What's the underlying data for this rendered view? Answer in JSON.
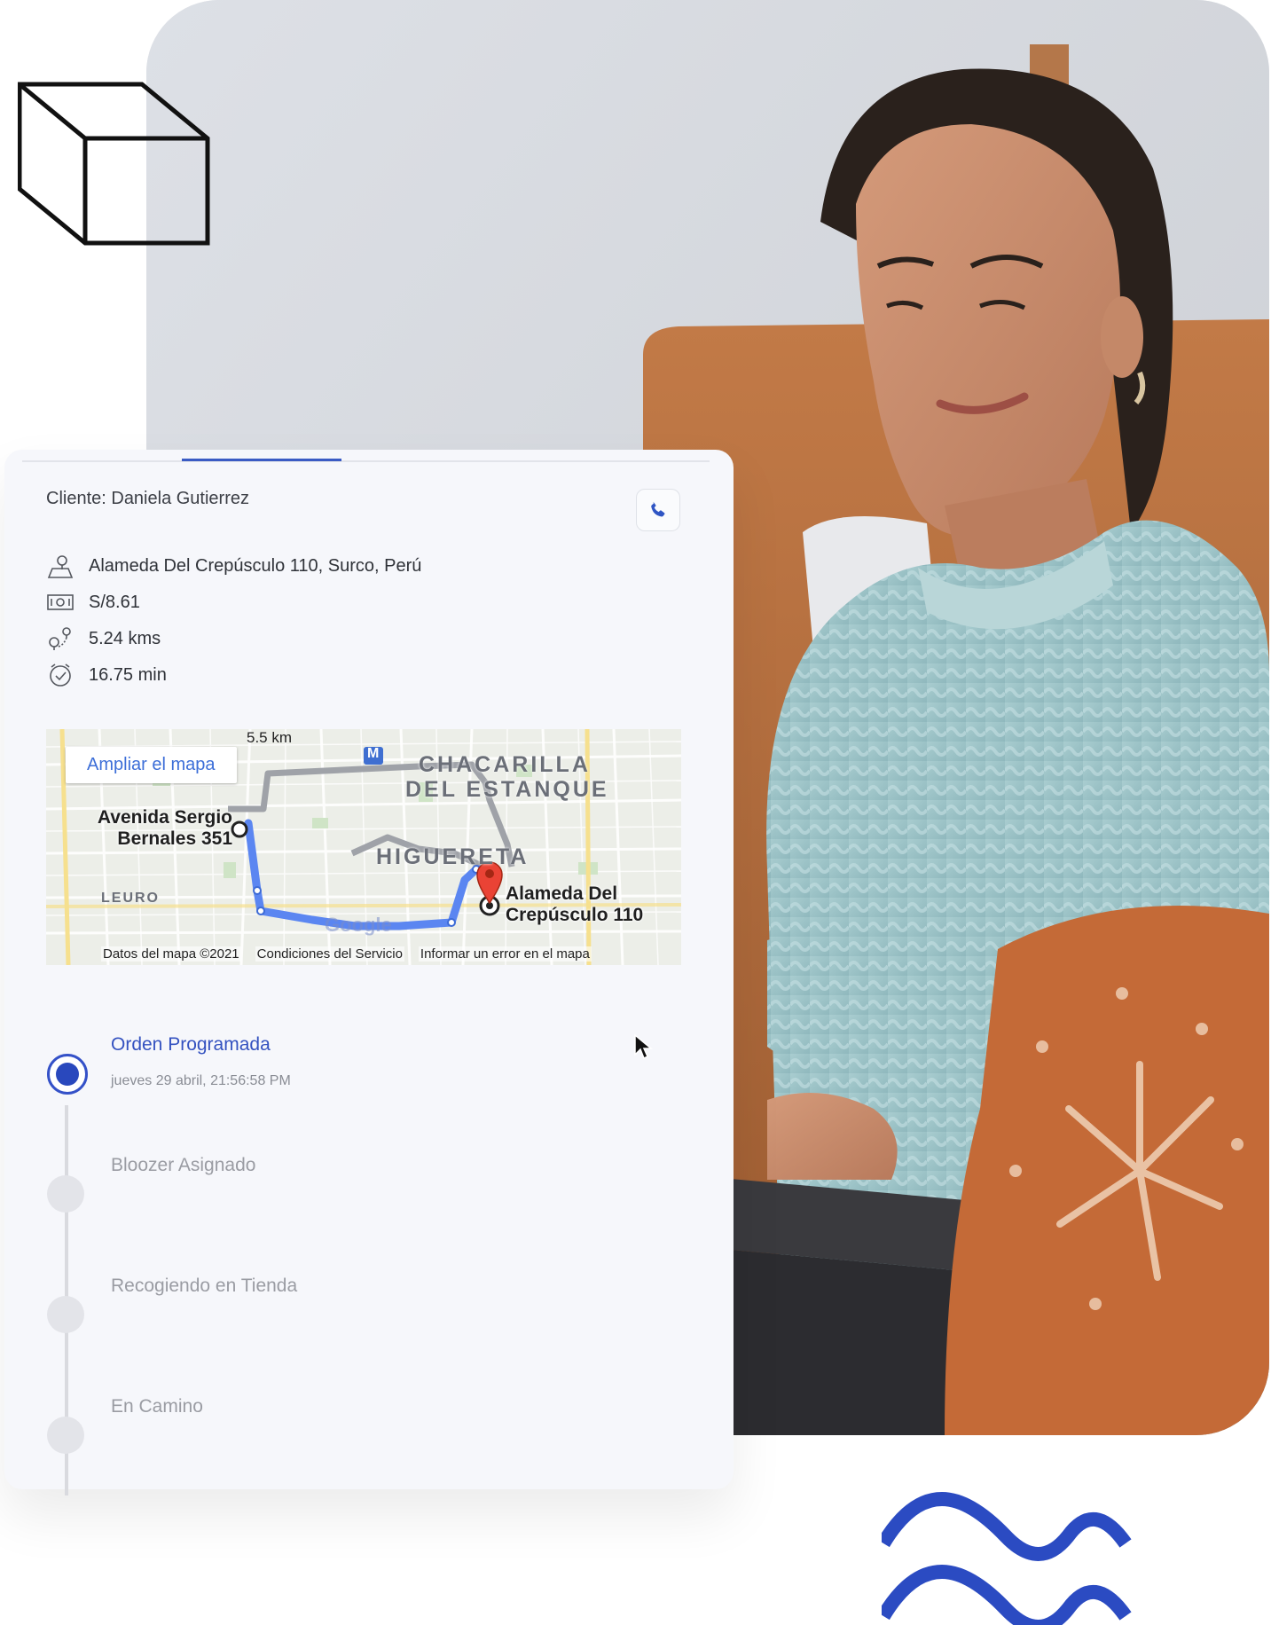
{
  "colors": {
    "accent": "#3452c0",
    "wave": "#2b4bc2",
    "card_bg": "#f6f7fb",
    "inactive": "#9a9ca3"
  },
  "order": {
    "client_label": "Cliente: Daniela Gutierrez",
    "phone_icon": "phone-icon",
    "address": "Alameda Del Crepúsculo 110, Surco, Perú",
    "price": "S/8.61",
    "distance": "5.24 kms",
    "duration": "16.75 min"
  },
  "map": {
    "expand_button": "Ampliar el mapa",
    "scale": "5.5 km",
    "origin_label": "Avenida Sergio Bernales 351",
    "origin_line1": "Avenida Sergio",
    "origin_line2": "Bernales 351",
    "destination_line1": "Alameda Del",
    "destination_line2": "Crepúsculo 110",
    "area1_line1": "CHACARILLA",
    "area1_line2": "DEL ESTANQUE",
    "area2": "HIGUERETA",
    "area3": "LEURO",
    "metro_badge": "M",
    "google": "Google",
    "footer_data": "Datos del mapa ©2021",
    "footer_terms": "Condiciones del Servicio",
    "footer_report": "Informar un error en el mapa"
  },
  "timeline": [
    {
      "title": "Orden Programada",
      "date": "jueves 29 abril, 21:56:58 PM",
      "active": true
    },
    {
      "title": "Bloozer Asignado",
      "active": false
    },
    {
      "title": "Recogiendo en Tienda",
      "active": false
    },
    {
      "title": "En Camino",
      "active": false
    }
  ]
}
